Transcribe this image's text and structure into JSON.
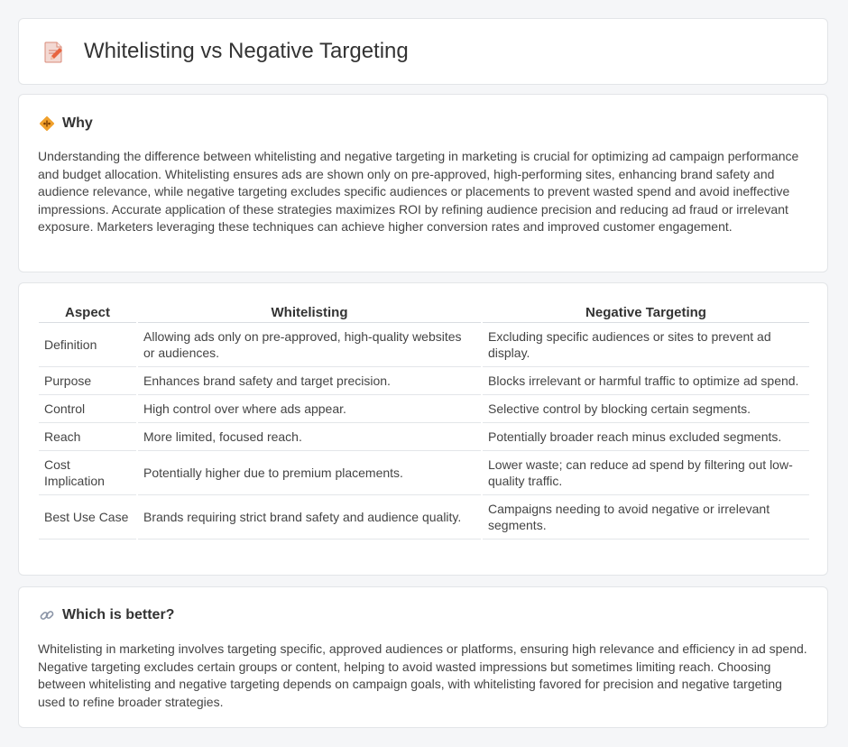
{
  "header": {
    "title": "Whitelisting vs Negative Targeting",
    "icon": "document-pencil-icon"
  },
  "why": {
    "title": "Why",
    "icon": "diamond-warning-icon",
    "body": "Understanding the difference between whitelisting and negative targeting in marketing is crucial for optimizing ad campaign performance and budget allocation. Whitelisting ensures ads are shown only on pre-approved, high-performing sites, enhancing brand safety and audience relevance, while negative targeting excludes specific audiences or placements to prevent wasted spend and avoid ineffective impressions. Accurate application of these strategies maximizes ROI by refining audience precision and reducing ad fraud or irrelevant exposure. Marketers leveraging these techniques can achieve higher conversion rates and improved customer engagement."
  },
  "table": {
    "headers": [
      "Aspect",
      "Whitelisting",
      "Negative Targeting"
    ],
    "rows": [
      [
        "Definition",
        "Allowing ads only on pre-approved, high-quality websites or audiences.",
        "Excluding specific audiences or sites to prevent ad display."
      ],
      [
        "Purpose",
        "Enhances brand safety and target precision.",
        "Blocks irrelevant or harmful traffic to optimize ad spend."
      ],
      [
        "Control",
        "High control over where ads appear.",
        "Selective control by blocking certain segments."
      ],
      [
        "Reach",
        "More limited, focused reach.",
        "Potentially broader reach minus excluded segments."
      ],
      [
        "Cost Implication",
        "Potentially higher due to premium placements.",
        "Lower waste; can reduce ad spend by filtering out low-quality traffic."
      ],
      [
        "Best Use Case",
        "Brands requiring strict brand safety and audience quality.",
        "Campaigns needing to avoid negative or irrelevant segments."
      ]
    ]
  },
  "which": {
    "title": "Which is better?",
    "icon": "link-icon",
    "body": "Whitelisting in marketing involves targeting specific, approved audiences or platforms, ensuring high relevance and efficiency in ad spend. Negative targeting excludes certain groups or content, helping to avoid wasted impressions but sometimes limiting reach. Choosing between whitelisting and negative targeting depends on campaign goals, with whitelisting favored for precision and negative targeting used to refine broader strategies."
  }
}
